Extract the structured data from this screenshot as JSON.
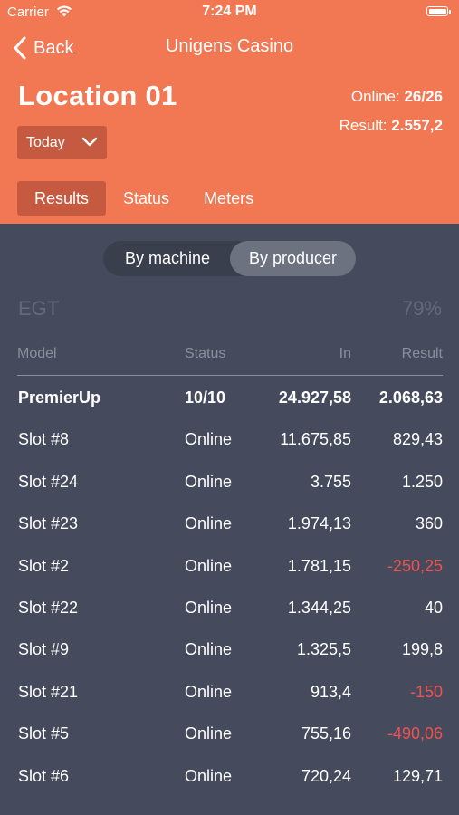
{
  "status_bar": {
    "carrier": "Carrier",
    "time": "7:24 PM"
  },
  "nav": {
    "back_label": "Back",
    "title": "Unigens Casino"
  },
  "location": {
    "title": "Location 01",
    "online_label": "Online:",
    "online_value": "26/26",
    "result_label": "Result:",
    "result_value": "2.557,2"
  },
  "period_dropdown": {
    "selected": "Today"
  },
  "tabs": [
    {
      "label": "Results",
      "active": true
    },
    {
      "label": "Status",
      "active": false
    },
    {
      "label": "Meters",
      "active": false
    }
  ],
  "segment": [
    {
      "label": "By machine",
      "active": false
    },
    {
      "label": "By producer",
      "active": true
    }
  ],
  "group": {
    "name": "EGT",
    "percent": "79%"
  },
  "table": {
    "headers": {
      "model": "Model",
      "status": "Status",
      "in": "In",
      "result": "Result"
    },
    "summary": {
      "model": "PremierUp",
      "status": "10/10",
      "in": "24.927,58",
      "result": "2.068,63"
    },
    "rows": [
      {
        "model": "Slot #8",
        "status": "Online",
        "in": "11.675,85",
        "result": "829,43",
        "negative": false
      },
      {
        "model": "Slot #24",
        "status": "Online",
        "in": "3.755",
        "result": "1.250",
        "negative": false
      },
      {
        "model": "Slot #23",
        "status": "Online",
        "in": "1.974,13",
        "result": "360",
        "negative": false
      },
      {
        "model": "Slot #2",
        "status": "Online",
        "in": "1.781,15",
        "result": "-250,25",
        "negative": true
      },
      {
        "model": "Slot #22",
        "status": "Online",
        "in": "1.344,25",
        "result": "40",
        "negative": false
      },
      {
        "model": "Slot #9",
        "status": "Online",
        "in": "1.325,5",
        "result": "199,8",
        "negative": false
      },
      {
        "model": "Slot #21",
        "status": "Online",
        "in": "913,4",
        "result": "-150",
        "negative": true
      },
      {
        "model": "Slot #5",
        "status": "Online",
        "in": "755,16",
        "result": "-490,06",
        "negative": true
      },
      {
        "model": "Slot #6",
        "status": "Online",
        "in": "720,24",
        "result": "129,71",
        "negative": false
      }
    ]
  },
  "colors": {
    "header": "#f17853",
    "accent_dark": "#c65a40",
    "background": "#454b5c",
    "negative": "#f0524f"
  }
}
